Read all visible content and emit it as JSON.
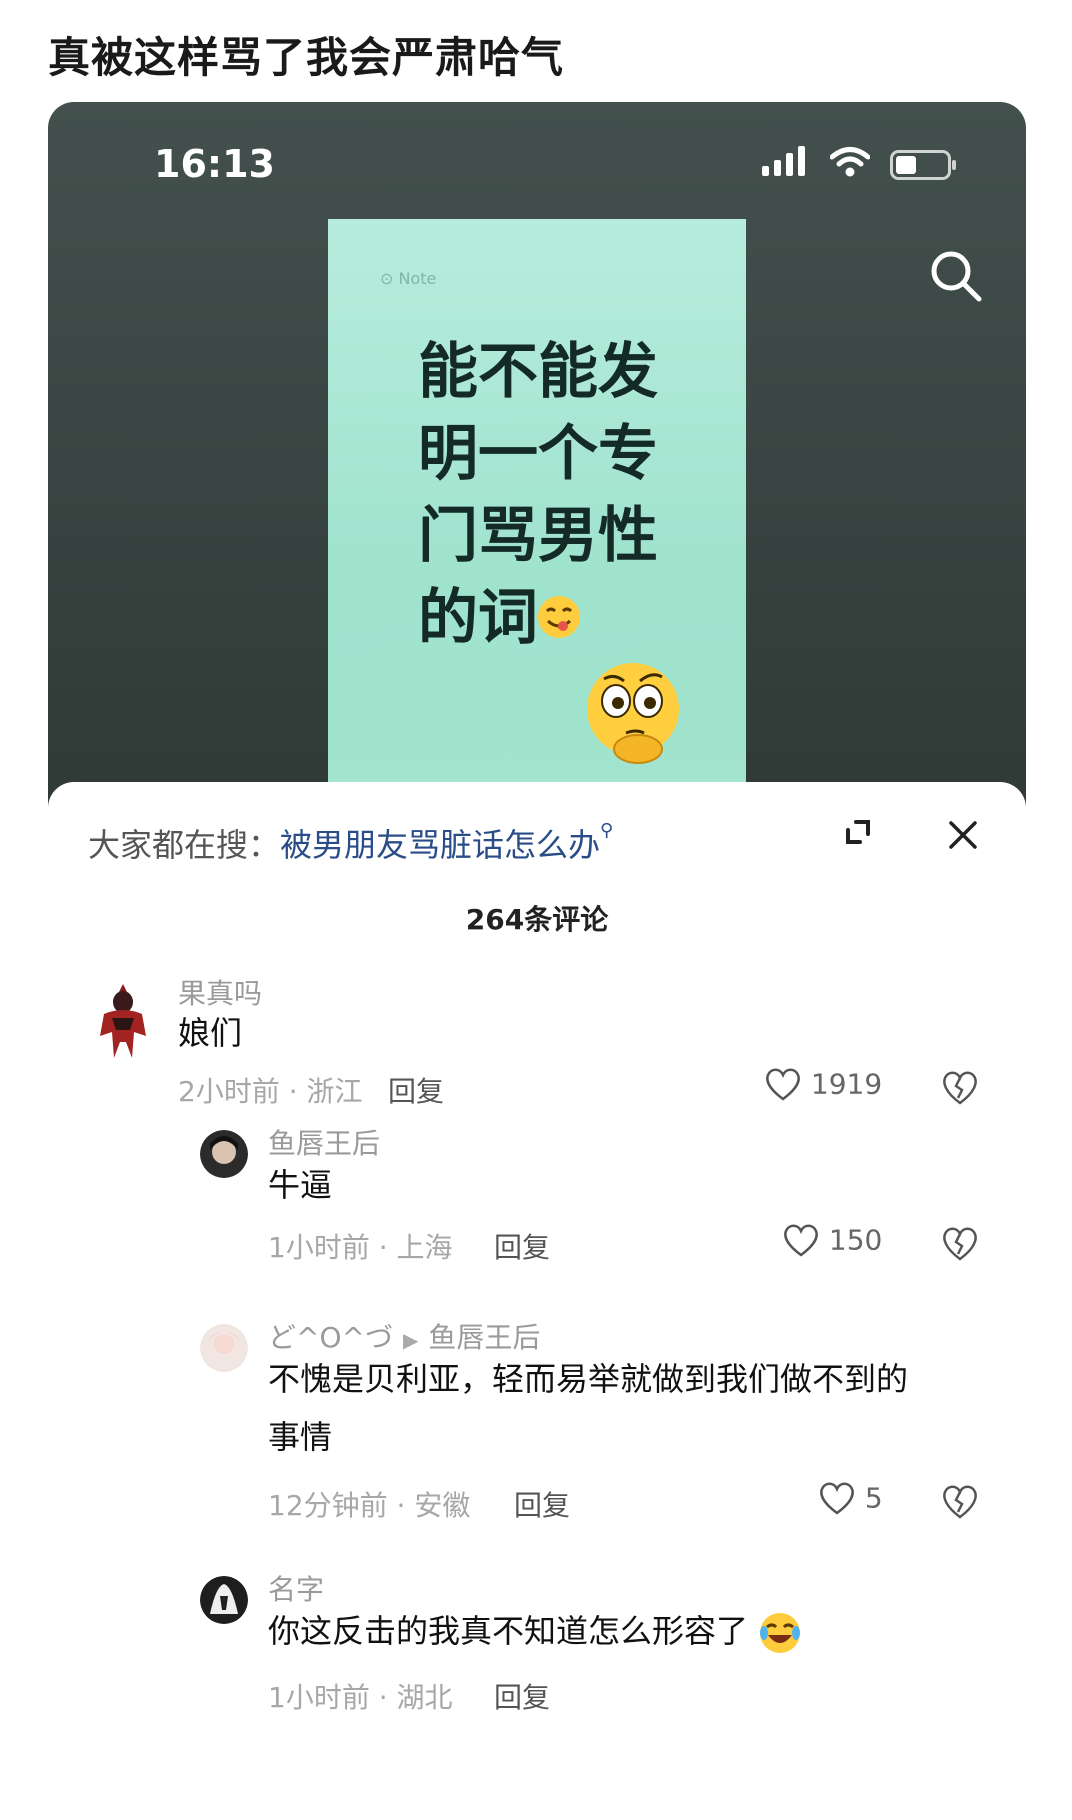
{
  "post": {
    "title": "真被这样骂了我会严肃哈气"
  },
  "status_bar": {
    "time": "16:13"
  },
  "video": {
    "watermark": "⊙ Note",
    "headline": "能不能发\n明一个专\n门骂男性\n的词"
  },
  "sheet": {
    "search_hint_prefix": "大家都在搜：",
    "search_hint_keyword": "被男朋友骂脏话怎么办",
    "comment_count": "264条评论"
  },
  "comments": [
    {
      "name": "果真吗",
      "text": "娘们",
      "time": "2小时前",
      "location": "浙江",
      "reply": "回复",
      "likes": "1919"
    },
    {
      "name": "鱼唇王后",
      "text": "牛逼",
      "time": "1小时前",
      "location": "上海",
      "reply": "回复",
      "likes": "150"
    },
    {
      "name": "ど^O^づ",
      "reply_to": "鱼唇王后",
      "text": "不愧是贝利亚，轻而易举就做到我们做不到的事情",
      "time": "12分钟前",
      "location": "安徽",
      "reply": "回复",
      "likes": "5"
    },
    {
      "name": "名字",
      "text": "你这反击的我真不知道怎么形容了",
      "time": "1小时前",
      "location": "湖北",
      "reply": "回复",
      "likes": ""
    }
  ],
  "meta_separator": " · ",
  "colors": {
    "video_bg": "#3b4744",
    "note_bg": "#a6e6d2",
    "keyword": "#2a4d88"
  }
}
